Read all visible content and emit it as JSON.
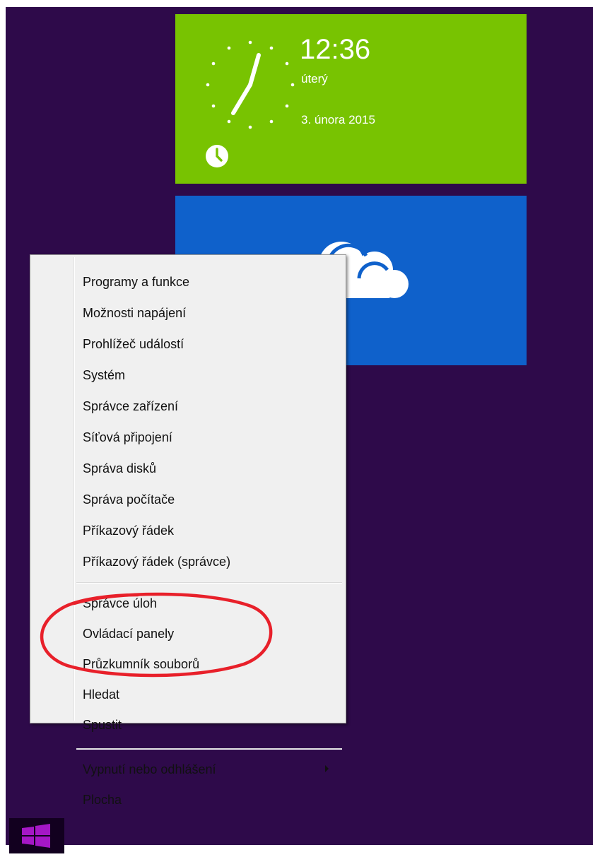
{
  "clock_tile": {
    "time": "12:36",
    "day": "úterý",
    "date": "3. února 2015",
    "icon": "clock-icon",
    "color": "#78c301"
  },
  "onedrive_tile": {
    "icon": "cloud-icon",
    "color": "#0f61cb"
  },
  "context_menu": {
    "group1": [
      "Programy a funkce",
      "Možnosti napájení",
      "Prohlížeč událostí",
      "Systém",
      "Správce zařízení",
      "Síťová připojení",
      "Správa disků",
      "Správa počítače",
      "Příkazový řádek",
      "Příkazový řádek (správce)"
    ],
    "group2": [
      "Správce úloh",
      "Ovládací panely",
      "Průzkumník souborů",
      "Hledat",
      "Spustit"
    ],
    "group3": [
      "Vypnutí nebo odhlášení",
      "Plocha"
    ],
    "submenu_icon": "chevron-right-icon"
  },
  "start_button": {
    "icon": "windows-logo-icon",
    "color": "#a517c6"
  },
  "annotation": {
    "color": "#e8202a"
  },
  "desktop_color": "#2e0a4a"
}
